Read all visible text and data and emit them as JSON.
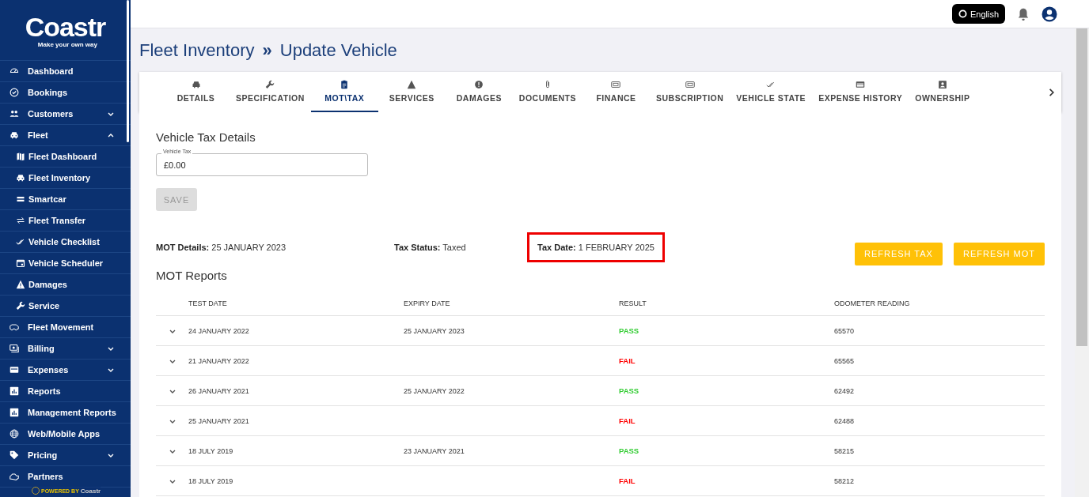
{
  "sidebar": {
    "logo": "Coastr",
    "tagline": "Make your own way",
    "items": [
      {
        "label": "Dashboard"
      },
      {
        "label": "Bookings"
      },
      {
        "label": "Customers",
        "expanded": false
      },
      {
        "label": "Fleet",
        "expanded": true,
        "children": [
          {
            "label": "Fleet Dashboard"
          },
          {
            "label": "Fleet Inventory"
          },
          {
            "label": "Smartcar"
          },
          {
            "label": "Fleet Transfer"
          },
          {
            "label": "Vehicle Checklist"
          },
          {
            "label": "Vehicle Scheduler"
          },
          {
            "label": "Damages"
          },
          {
            "label": "Service"
          }
        ]
      },
      {
        "label": "Fleet Movement"
      },
      {
        "label": "Billing",
        "expanded": false
      },
      {
        "label": "Expenses",
        "expanded": false
      },
      {
        "label": "Reports"
      },
      {
        "label": "Management Reports"
      },
      {
        "label": "Web/Mobile Apps"
      },
      {
        "label": "Pricing",
        "expanded": false
      },
      {
        "label": "Partners"
      }
    ],
    "powered_by": "POWERED BY",
    "powered_logo": "Coastr"
  },
  "topbar": {
    "language": "English"
  },
  "breadcrumb": {
    "parent": "Fleet Inventory",
    "separator": "»",
    "current": "Update Vehicle"
  },
  "tabs": [
    {
      "label": "DETAILS",
      "selected": false
    },
    {
      "label": "SPECIFICATION",
      "selected": false
    },
    {
      "label": "MOT\\TAX",
      "selected": true
    },
    {
      "label": "SERVICES",
      "selected": false
    },
    {
      "label": "DAMAGES",
      "selected": false
    },
    {
      "label": "DOCUMENTS",
      "selected": false
    },
    {
      "label": "FINANCE",
      "selected": false
    },
    {
      "label": "SUBSCRIPTION",
      "selected": false
    },
    {
      "label": "VEHICLE STATE",
      "selected": false
    },
    {
      "label": "EXPENSE HISTORY",
      "selected": false
    },
    {
      "label": "OWNERSHIP",
      "selected": false
    }
  ],
  "tax_section": {
    "title": "Vehicle Tax Details",
    "field": {
      "label": "Vehicle Tax",
      "value": "£0.00"
    },
    "save_button": {
      "label": "SAVE",
      "disabled": true
    }
  },
  "summary": [
    {
      "label": "MOT Details:",
      "value": "25 JANUARY 2023",
      "highlighted": false
    },
    {
      "label": "Tax Status:",
      "value": "Taxed",
      "highlighted": false
    },
    {
      "label": "Tax Date:",
      "value": "1 FEBRUARY 2025",
      "highlighted": true
    }
  ],
  "actions": [
    "REFRESH TAX",
    "REFRESH MOT"
  ],
  "mot_reports": {
    "title": "MOT Reports",
    "columns": [
      "TEST DATE",
      "EXPIRY DATE",
      "RESULT",
      "ODOMETER READING"
    ],
    "rows": [
      {
        "test_date": "24 JANUARY 2022",
        "expiry_date": "25 JANUARY 2023",
        "result": "PASS",
        "color": "#33cc33",
        "odometer": "65570"
      },
      {
        "test_date": "21 JANUARY 2022",
        "result": "FAIL",
        "color": "#ff0000",
        "odometer": "65565"
      },
      {
        "test_date": "26 JANUARY 2021",
        "expiry_date": "25 JANUARY 2022",
        "result": "PASS",
        "color": "#33cc33",
        "odometer": "62492"
      },
      {
        "test_date": "25 JANUARY 2021",
        "result": "FAIL",
        "color": "#ff0000",
        "odometer": "62488"
      },
      {
        "test_date": "18 JULY 2019",
        "expiry_date": "23 JANUARY 2021",
        "result": "PASS",
        "color": "#33cc33",
        "odometer": "58215"
      },
      {
        "test_date": "18 JULY 2019",
        "result": "FAIL",
        "color": "#ff0000",
        "odometer": "58212"
      }
    ]
  }
}
